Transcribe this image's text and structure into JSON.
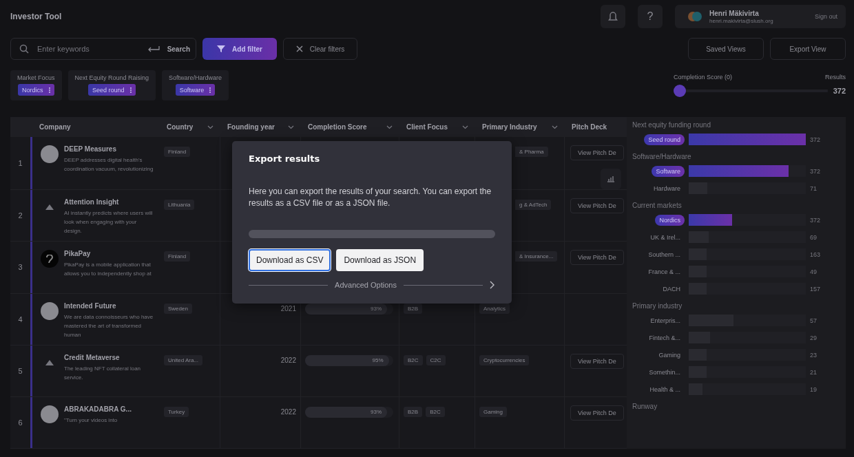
{
  "app_title": "Investor Tool",
  "header": {
    "user_name": "Henri Mäkivirta",
    "user_email": "henri.makivirta@slush.org",
    "sign_out": "Sign out",
    "help": "?"
  },
  "toolbar": {
    "search_placeholder": "Enter keywords",
    "search_button": "Search",
    "add_filter": "Add filter",
    "clear_filters": "Clear filters",
    "saved_views": "Saved Views",
    "export_view": "Export View"
  },
  "active_filters": [
    {
      "label": "Market Focus",
      "value": "Nordics"
    },
    {
      "label": "Next Equity Round Raising",
      "value": "Seed round"
    },
    {
      "label": "Software/Hardware",
      "value": "Software"
    }
  ],
  "score_filter": {
    "label": "Completion Score (0)",
    "level": 0,
    "results_label": "Results",
    "results": "372"
  },
  "table": {
    "columns": [
      "Company",
      "Country",
      "Founding year",
      "Completion Score",
      "Client Focus",
      "Primary Industry",
      "Pitch Deck"
    ],
    "rows": [
      {
        "index": "1",
        "name": "DEEP Measures",
        "logo": {
          "kind": "round"
        },
        "description": "DEEP addresses digital health's coordination vacuum, revolutionizing",
        "country": "Finland",
        "industry": "& Pharma",
        "industry_cut": true,
        "pitch": "View Pitch De",
        "chart_icon": true
      },
      {
        "index": "2",
        "name": "Attention Insight",
        "logo": {
          "kind": "small"
        },
        "description": "AI instantly predicts where users will look when engaging with your design.",
        "country": "Lithuania",
        "industry": "g & AdTech",
        "industry_cut": true,
        "pitch": "View Pitch De"
      },
      {
        "index": "3",
        "name": "PikaPay",
        "logo": {
          "kind": "dark"
        },
        "description": "PikaPay is a mobile application that allows you to independently shop at",
        "country": "Finland",
        "industry": "& Insurance...",
        "industry_cut": true,
        "pitch": "View Pitch De"
      },
      {
        "index": "4",
        "name": "Intended Future",
        "logo": {
          "kind": "round"
        },
        "description": "We are data connoisseurs who have mastered the art of transformed human",
        "country": "Sweden",
        "year": "2021",
        "score": "93%",
        "level": 0.93,
        "client": [
          "B2B"
        ],
        "industry": "Analytics"
      },
      {
        "index": "5",
        "name": "Credit Metaverse",
        "logo": {
          "kind": "small"
        },
        "description": "The leading NFT collateral loan service.",
        "country": "United Ara...",
        "year": "2022",
        "score": "95%",
        "level": 0.95,
        "client": [
          "B2C",
          "C2C"
        ],
        "industry": "Cryptocurrencies",
        "pitch": "View Pitch De"
      },
      {
        "index": "6",
        "name": "ABRAKADABRA G...",
        "logo": {
          "kind": "round"
        },
        "description": "\"Turn your videos into",
        "country": "Turkey",
        "year": "2022",
        "score": "93%",
        "level": 0.93,
        "client": [
          "B2B",
          "B2C"
        ],
        "industry": "Gaming",
        "pitch": "View Pitch De"
      }
    ]
  },
  "side_panel": [
    {
      "title": "Next equity funding round",
      "items": [
        {
          "label": "Seed round",
          "selected": true,
          "level": 1,
          "count": "372"
        }
      ]
    },
    {
      "title": "Software/Hardware",
      "items": [
        {
          "label": "Software",
          "selected": true,
          "level": 0.85,
          "count": "372"
        },
        {
          "label": "Hardware",
          "selected": false,
          "level": 0.16,
          "count": "71"
        }
      ]
    },
    {
      "title": "Current markets",
      "items": [
        {
          "label": "Nordics",
          "selected": true,
          "level": 0.37,
          "count": "372"
        },
        {
          "label": "UK & Irel...",
          "selected": false,
          "level": 0.17,
          "count": "69"
        },
        {
          "label": "Southern ...",
          "selected": false,
          "level": 0.15,
          "count": "163"
        },
        {
          "label": "France & ...",
          "selected": false,
          "level": 0.15,
          "count": "49"
        },
        {
          "label": "DACH",
          "selected": false,
          "level": 0.15,
          "count": "157"
        }
      ]
    },
    {
      "title": "Primary industry",
      "items": [
        {
          "label": "Enterpris...",
          "selected": false,
          "level": 0.38,
          "count": "57"
        },
        {
          "label": "Fintech &...",
          "selected": false,
          "level": 0.18,
          "count": "29"
        },
        {
          "label": "Gaming",
          "selected": false,
          "level": 0.15,
          "count": "23"
        },
        {
          "label": "Somethin...",
          "selected": false,
          "level": 0.15,
          "count": "21"
        },
        {
          "label": "Health & ...",
          "selected": false,
          "level": 0.12,
          "count": "19"
        }
      ]
    },
    {
      "title": "Runway"
    }
  ],
  "dialog": {
    "title": "Export results",
    "text": "Here you can export the results of your search. You can export the results as a CSV file or as a JSON file.",
    "progress": {
      "level": 0
    },
    "buttons": [
      {
        "label": "Download as CSV",
        "selected": true
      },
      {
        "label": "Download as JSON",
        "selected": false
      }
    ],
    "advanced": "Advanced Options"
  }
}
